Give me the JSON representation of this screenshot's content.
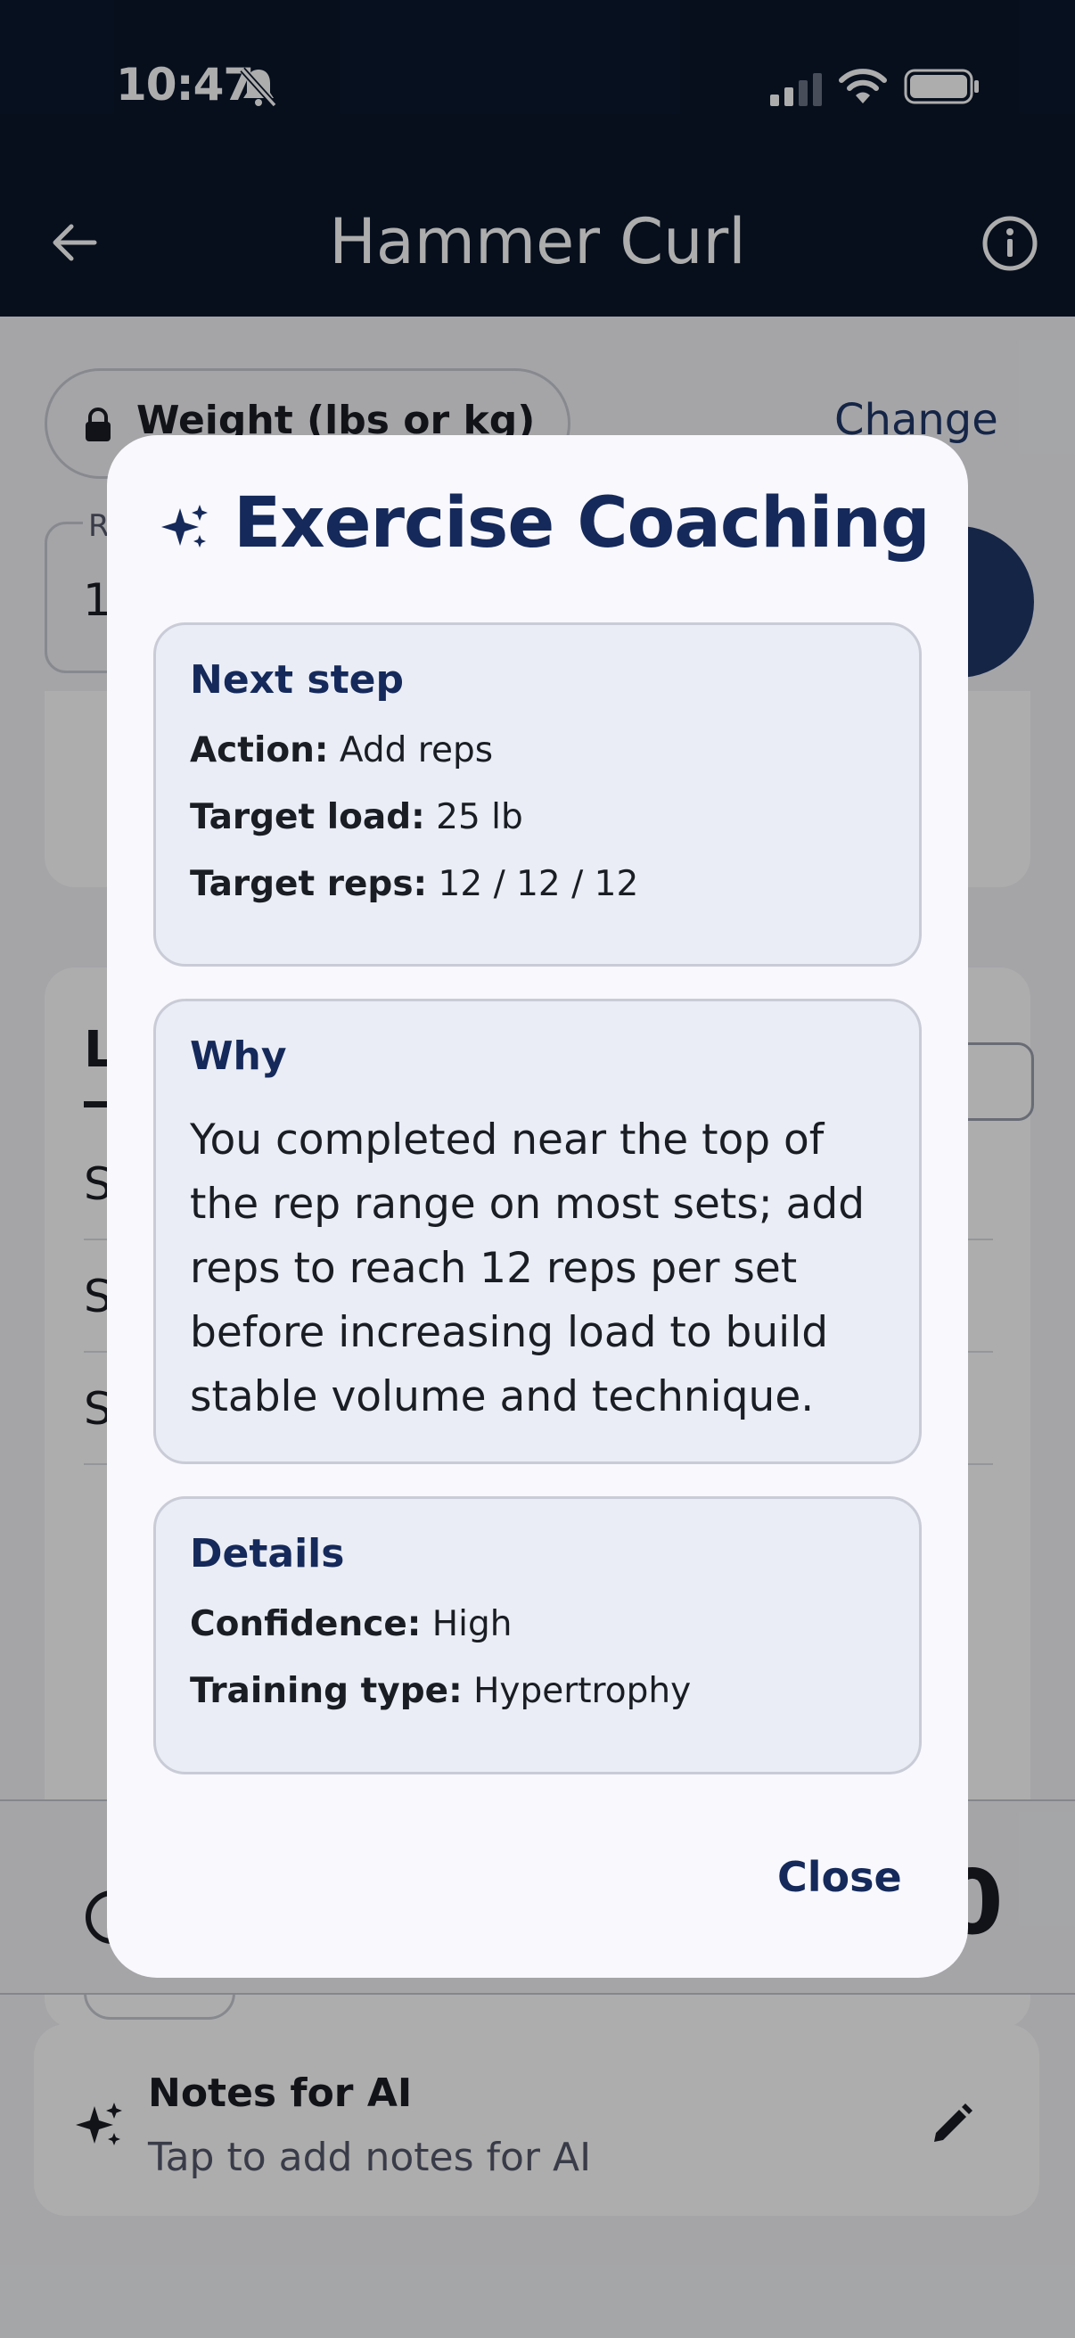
{
  "status_bar": {
    "time": "10:47"
  },
  "app_bar": {
    "title": "Hammer Curl"
  },
  "background": {
    "unit_chip_label": "Weight (lbs or kg)",
    "change_label": "Change",
    "reps_label": "R",
    "reps_value": "1",
    "card_letter": "L",
    "set_rows": [
      "S",
      "S",
      "S"
    ],
    "bottom_value": "0"
  },
  "notes": {
    "title": "Notes for AI",
    "subtitle": "Tap to add notes for AI"
  },
  "dialog": {
    "title": "Exercise Coaching",
    "next_step": {
      "heading": "Next step",
      "action_label": "Action:",
      "action_value": "Add reps",
      "load_label": "Target load:",
      "load_value": "25 lb",
      "reps_label": "Target reps:",
      "reps_value": "12 / 12 / 12"
    },
    "why": {
      "heading": "Why",
      "text": "You completed near the top of the rep range on most sets; add reps to reach 12 reps per set before increasing load to build stable volume and technique."
    },
    "details": {
      "heading": "Details",
      "confidence_label": "Confidence:",
      "confidence_value": "High",
      "type_label": "Training type:",
      "type_value": "Hypertrophy"
    },
    "close_label": "Close"
  },
  "colors": {
    "primary": "#15295a",
    "app_bar": "#0b172c",
    "surface": "#f8f8fd",
    "section": "#eaedf5"
  }
}
